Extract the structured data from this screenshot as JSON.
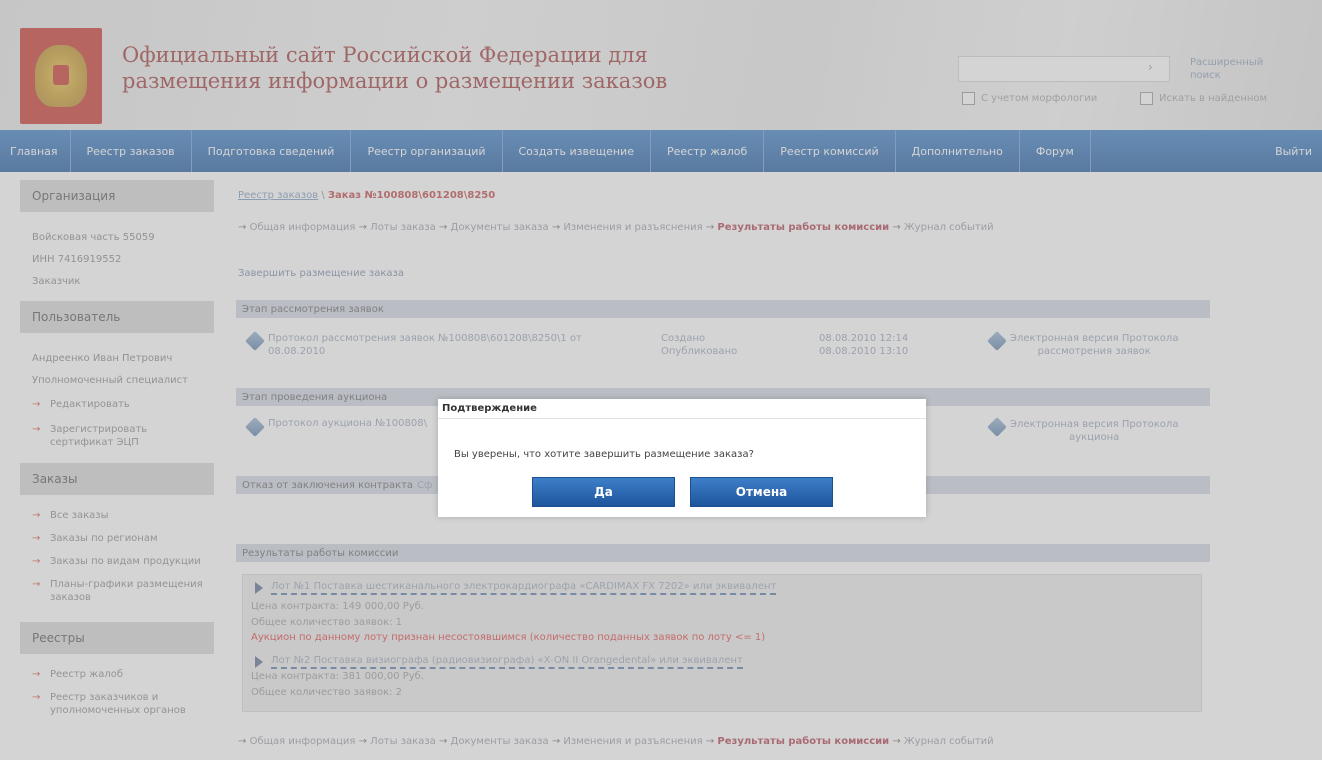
{
  "header": {
    "title_line1": "Официальный сайт Российской Федерации для",
    "title_line2": "размещения информации о размещении заказов",
    "emblem_icon": "coat-of-arms-icon",
    "search": {
      "value": "",
      "arrow": "›"
    },
    "advanced_search_line1": "Расширенный",
    "advanced_search_line2": "поиск",
    "checkbox_morphology": "С учетом морфологии",
    "checkbox_in_found": "Искать в найденном"
  },
  "nav": {
    "items": [
      "Главная",
      "Реестр заказов",
      "Подготовка сведений",
      "Реестр организаций",
      "Создать извещение",
      "Реестр жалоб",
      "Реестр комиссий",
      "Дополнительно",
      "Форум"
    ],
    "logout": "Выйти"
  },
  "sidebar": {
    "org_head": "Организация",
    "org_name": "Войсковая часть 55059",
    "org_inn": "ИНН 7416919552",
    "org_role": "Заказчик",
    "user_head": "Пользователь",
    "user_name": "Андреенко Иван Петрович",
    "user_role": "Уполномоченный специалист",
    "user_links": [
      "Редактировать",
      "Зарегистрировать сертификат ЭЦП"
    ],
    "orders_head": "Заказы",
    "orders_links": [
      "Все заказы",
      "Заказы по регионам",
      "Заказы по видам продукции",
      "Планы-графики размещения заказов"
    ],
    "registry_head": "Реестры",
    "registry_links": [
      "Реестр жалоб",
      "Реестр заказчиков и уполномоченных органов"
    ],
    "arrow": "→"
  },
  "main": {
    "breadcrumb_root": "Реестр заказов",
    "breadcrumb_sep": " \\ ",
    "breadcrumb_current": "Заказ №100808\\601208\\8250",
    "flow": [
      "Общая информация",
      "Лоты заказа",
      "Документы заказа",
      "Изменения и разъяснения",
      "Результаты работы комиссии",
      "Журнал событий"
    ],
    "flow_arrow": "→",
    "finish_link": "Завершить размещение заказа",
    "stage1_head": "Этап рассмотрения заявок",
    "stage1_doc_line1": "Протокол рассмотрения заявок №100808\\601208\\8250\\1 от",
    "stage1_doc_line2": "08.08.2010",
    "stage1_status1": "Создано",
    "stage1_status2": "Опубликовано",
    "stage1_date1": "08.08.2010 12:14",
    "stage1_date2": "08.08.2010 13:10",
    "stage1_elec_line1": "Электронная версия Протокола",
    "stage1_elec_line2": "рассмотрения заявок",
    "stage2_head": "Этап проведения аукциона",
    "stage2_doc": "Протокол аукциона №100808\\",
    "stage2_elec_line1": "Электронная версия Протокола",
    "stage2_elec_line2": "аукциона",
    "refusal_head": "Отказ от заключения контракта",
    "refusal_link": "Сф",
    "results_head": "Результаты работы комиссии",
    "lot1_title": "Лот №1 Поставка шестиканального электрокардиографа «CARDIMAX FX 7202» или эквивалент",
    "lot1_price": "Цена контракта: 149 000,00  Руб.",
    "lot1_count": "Общее количество заявок: 1",
    "lot1_fail": "Аукцион по данному лоту признан несостоявшимся (количество поданных заявок по лоту <= 1)",
    "lot2_title": "Лот №2 Поставка визиографа (радиовизиографа) «X-ON II Orangedental» или эквивалент",
    "lot2_price": "Цена контракта: 381 000,00  Руб.",
    "lot2_count": "Общее количество заявок: 2"
  },
  "dialog": {
    "title": "Подтверждение",
    "message": "Вы уверены, что хотите завершить размещение заказа?",
    "yes": "Да",
    "cancel": "Отмена"
  }
}
